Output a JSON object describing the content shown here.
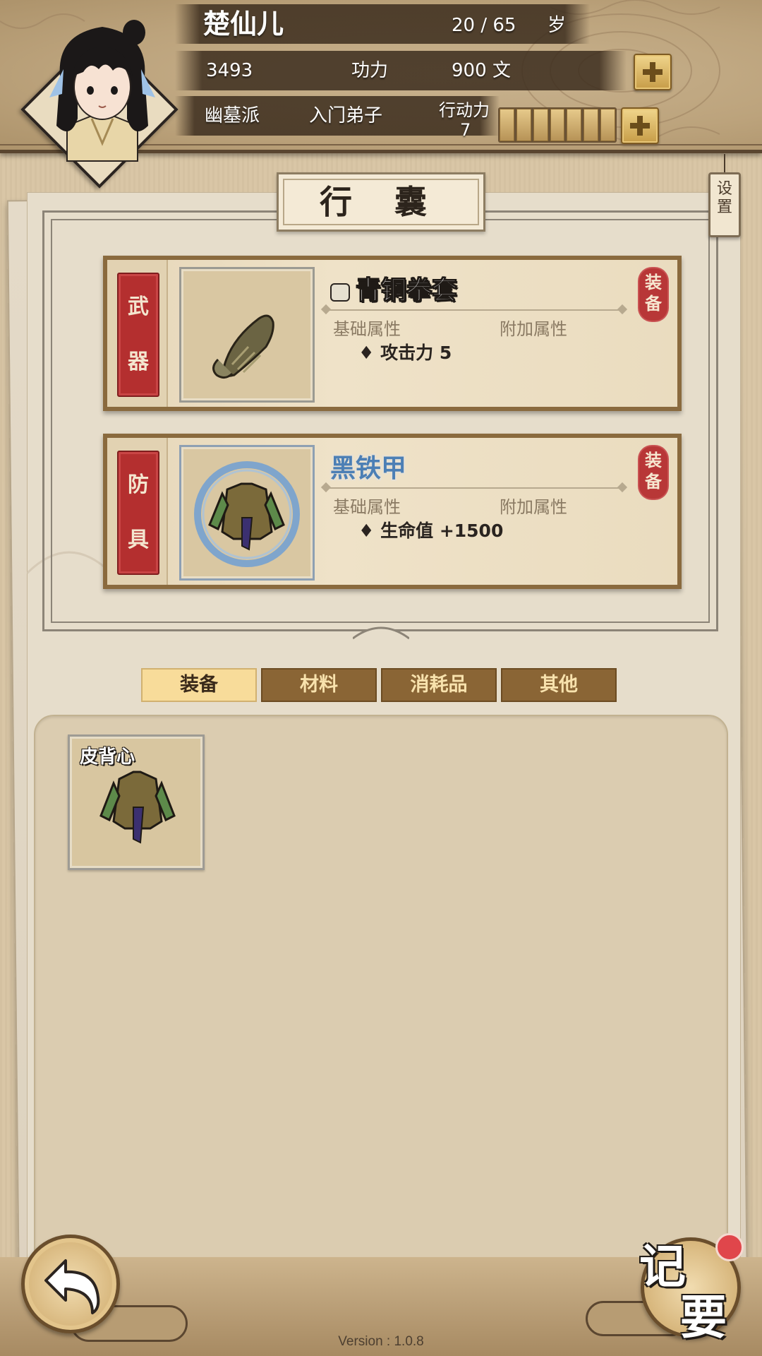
{
  "header": {
    "name": "楚仙儿",
    "age": "20 / 65",
    "age_unit": "岁",
    "power_value": "3493",
    "power_label": "功力",
    "money_value": "900",
    "money_unit": "文",
    "sect": "幽墓派",
    "rank": "入门弟子",
    "stamina_label": "行动力",
    "stamina_value": "7"
  },
  "panel": {
    "title": "行 囊",
    "settings_label": "设置"
  },
  "equipped": [
    {
      "slot_label": "武器",
      "item_name": "青铜拳套",
      "base_attr_label": "基础属性",
      "extra_attr_label": "附加属性",
      "stat": "♦ 攻击力 5",
      "stamp": "装备"
    },
    {
      "slot_label": "防具",
      "item_name": "黑铁甲",
      "base_attr_label": "基础属性",
      "extra_attr_label": "附加属性",
      "stat": "♦ 生命值 +1500",
      "stamp": "装备"
    }
  ],
  "tabs": [
    {
      "label": "装备",
      "active": true
    },
    {
      "label": "材料",
      "active": false
    },
    {
      "label": "消耗品",
      "active": false
    },
    {
      "label": "其他",
      "active": false
    }
  ],
  "inventory": [
    {
      "name": "皮背心",
      "icon": "leather-vest-icon"
    }
  ],
  "footer": {
    "notes_label": "记要",
    "version": "Version : 1.0.8"
  },
  "colors": {
    "accent_gold": "#f8dc9a",
    "tab_brown": "#8a6535",
    "ribbon_red": "#b42f2f",
    "rare_blue": "#4c7fb5"
  }
}
